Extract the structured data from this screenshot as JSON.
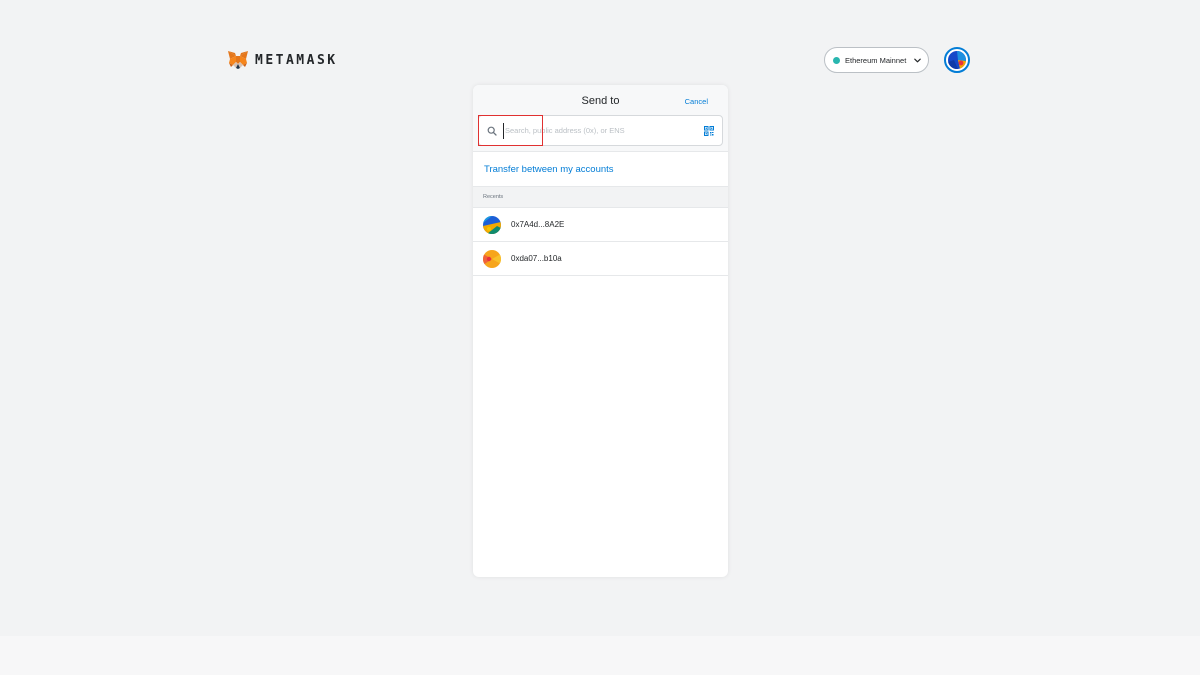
{
  "header": {
    "brand": "METAMASK",
    "network": {
      "name": "Ethereum Mainnet",
      "dot_color": "#29b6af"
    },
    "account_icon": "account-identicon"
  },
  "send": {
    "title": "Send to",
    "cancel_label": "Cancel",
    "search": {
      "value": "",
      "placeholder": "Search, public address (0x), or ENS",
      "icon": "search-icon",
      "qr_icon": "qr-code-icon"
    },
    "transfer_label": "Transfer between my accounts",
    "recents_label": "Recents",
    "recents": [
      {
        "address": "0x7A4d...8A2E"
      },
      {
        "address": "0xda07...b10a"
      }
    ]
  },
  "colors": {
    "accent": "#037dd6",
    "highlight": "#e03131",
    "background": "#f2f3f4"
  }
}
